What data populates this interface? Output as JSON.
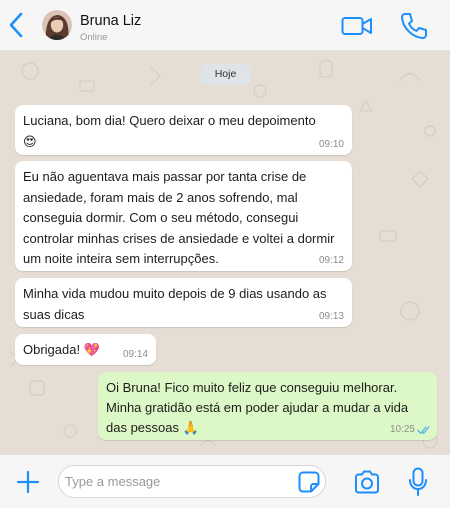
{
  "header": {
    "contact_name": "Bruna Liz",
    "contact_status": "Online",
    "back_icon": "chevron-left-icon",
    "video_icon": "video-call-icon",
    "call_icon": "phone-icon"
  },
  "chat": {
    "day_label": "Hoje",
    "messages": [
      {
        "direction": "in",
        "text": "Luciana, bom dia! Quero deixar o meu depoimento\n😍",
        "time": "09:10"
      },
      {
        "direction": "in",
        "text": "Eu não aguentava mais passar por tanta crise de ansiedade, foram mais de 2 anos sofrendo, mal conseguia dormir. Com o seu método, consegui controlar minhas crises de ansiedade e voltei a dormir um noite inteira sem interrupções.",
        "time": "09:12"
      },
      {
        "direction": "in",
        "text": "Minha vida mudou muito depois de 9 dias usando as suas dicas",
        "time": "09:13"
      },
      {
        "direction": "in",
        "text": "Obrigada! 💖",
        "time": "09:14"
      },
      {
        "direction": "out",
        "text": "Oi Bruna! Fico muito feliz que conseguiu melhorar. Minha gratidão está em poder ajudar a mudar a vida das pessoas 🙏",
        "time": "10:25",
        "status": "read"
      }
    ]
  },
  "composer": {
    "placeholder": "Type a message",
    "value": ""
  },
  "colors": {
    "accent": "#1e8ffa",
    "incoming_bubble": "#ffffff",
    "outgoing_bubble": "#dcf8c6",
    "chat_background": "#e6ded5",
    "read_ticks": "#4fb4e8"
  }
}
